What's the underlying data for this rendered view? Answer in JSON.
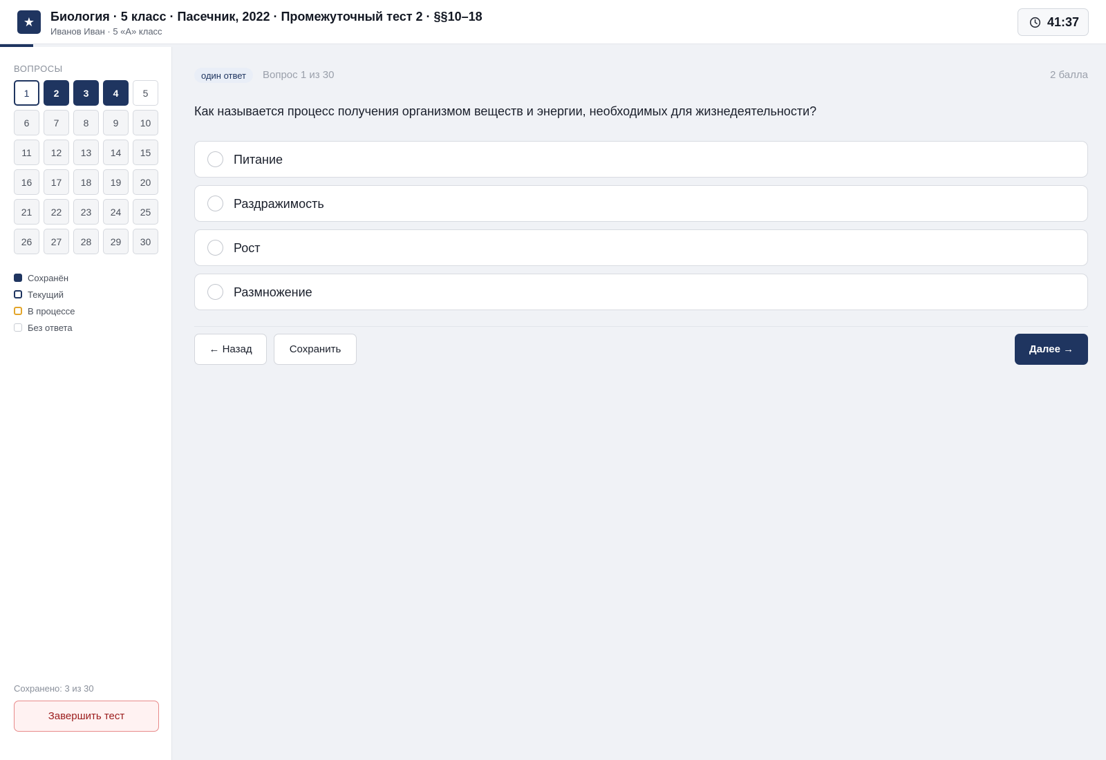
{
  "header": {
    "logo_glyph": "★",
    "title": "Биология · 5 класс · Пасечник, 2022 · Промежуточный тест 2 · §§10–18",
    "subtitle": "Иванов Иван · 5 «А» класс",
    "timer": "41:37",
    "progress_fraction": 0.03,
    "icons": {
      "logo": "star-icon",
      "timer": "clock-icon"
    },
    "accent_color": "#1f3560"
  },
  "sidebar": {
    "heading": "ВОПРОСЫ",
    "questions": [
      {
        "n": "1",
        "state": "current"
      },
      {
        "n": "2",
        "state": "saved"
      },
      {
        "n": "3",
        "state": "saved"
      },
      {
        "n": "4",
        "state": "saved"
      },
      {
        "n": "5",
        "state": "unanswered"
      },
      {
        "n": "6",
        "state": "empty"
      },
      {
        "n": "7",
        "state": "empty"
      },
      {
        "n": "8",
        "state": "empty"
      },
      {
        "n": "9",
        "state": "empty"
      },
      {
        "n": "10",
        "state": "empty"
      },
      {
        "n": "11",
        "state": "empty"
      },
      {
        "n": "12",
        "state": "empty"
      },
      {
        "n": "13",
        "state": "empty"
      },
      {
        "n": "14",
        "state": "empty"
      },
      {
        "n": "15",
        "state": "empty"
      },
      {
        "n": "16",
        "state": "empty"
      },
      {
        "n": "17",
        "state": "empty"
      },
      {
        "n": "18",
        "state": "empty"
      },
      {
        "n": "19",
        "state": "empty"
      },
      {
        "n": "20",
        "state": "empty"
      },
      {
        "n": "21",
        "state": "empty"
      },
      {
        "n": "22",
        "state": "empty"
      },
      {
        "n": "23",
        "state": "empty"
      },
      {
        "n": "24",
        "state": "empty"
      },
      {
        "n": "25",
        "state": "empty"
      },
      {
        "n": "26",
        "state": "empty"
      },
      {
        "n": "27",
        "state": "empty"
      },
      {
        "n": "28",
        "state": "empty"
      },
      {
        "n": "29",
        "state": "empty"
      },
      {
        "n": "30",
        "state": "empty"
      }
    ],
    "legend": [
      {
        "key": "saved",
        "label": "Сохранён"
      },
      {
        "key": "current",
        "label": "Текущий"
      },
      {
        "key": "progress",
        "label": "В процессе"
      },
      {
        "key": "none",
        "label": "Без ответа"
      }
    ],
    "saved_count": "Сохранено: 3 из 30",
    "finish_label": "Завершить тест",
    "status_colors": {
      "saved": "#1f3560",
      "in_progress": "#e3a52a",
      "finish": "#9b1c1c"
    }
  },
  "main": {
    "badge": "один ответ",
    "question_number": "Вопрос 1 из 30",
    "points": "2 балла",
    "question_text": "Как называется процесс получения организмом веществ и энергии, необходимых для жизнедеятельности?",
    "options": [
      "Питание",
      "Раздражимость",
      "Рост",
      "Размножение"
    ],
    "back_label": "← Назад",
    "save_label": "Сохранить",
    "next_label": "Далее →"
  }
}
